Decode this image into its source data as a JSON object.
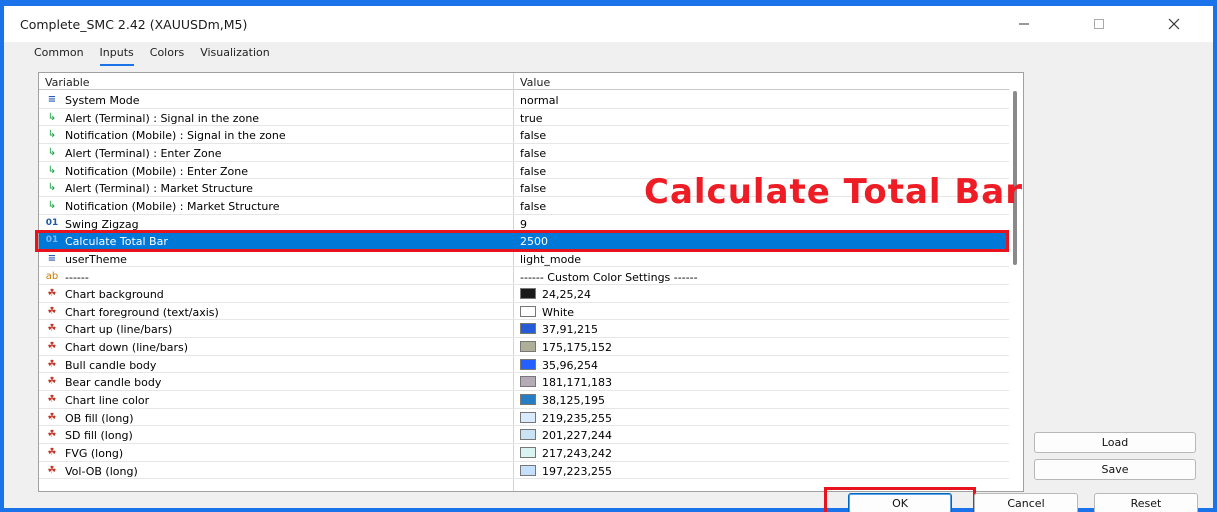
{
  "window": {
    "title": "Complete_SMC 2.42 (XAUUSDm,M5)"
  },
  "tabs": [
    "Common",
    "Inputs",
    "Colors",
    "Visualization"
  ],
  "active_tab": "Inputs",
  "table": {
    "headers": {
      "variable": "Variable",
      "value": "Value"
    },
    "rows": [
      {
        "icon": "system-mode-icon",
        "name": "System Mode",
        "value": "normal"
      },
      {
        "icon": "alert-arrow-icon",
        "name": "Alert (Terminal) : Signal in the zone",
        "value": "true"
      },
      {
        "icon": "alert-arrow-icon",
        "name": "Notification (Mobile) : Signal in the zone",
        "value": "false"
      },
      {
        "icon": "alert-arrow-icon",
        "name": "Alert (Terminal) : Enter Zone",
        "value": "false"
      },
      {
        "icon": "alert-arrow-icon",
        "name": "Notification (Mobile) : Enter Zone",
        "value": "false"
      },
      {
        "icon": "alert-arrow-icon",
        "name": "Alert (Terminal) : Market Structure",
        "value": "false"
      },
      {
        "icon": "alert-arrow-icon",
        "name": "Notification (Mobile) : Market Structure",
        "value": "false"
      },
      {
        "icon": "integer-icon",
        "name": "Swing Zigzag",
        "value": "9"
      },
      {
        "icon": "integer-icon",
        "name": "Calculate Total Bar",
        "value": "2500",
        "selected": true
      },
      {
        "icon": "system-mode-icon",
        "name": "userTheme",
        "value": "light_mode"
      },
      {
        "icon": "string-icon",
        "name": "------",
        "value": "------ Custom Color Settings ------"
      },
      {
        "icon": "color-icon",
        "name": "Chart background",
        "value": "24,25,24",
        "swatch": "#181918"
      },
      {
        "icon": "color-icon",
        "name": "Chart foreground (text/axis)",
        "value": "White",
        "swatch": "#ffffff"
      },
      {
        "icon": "color-icon",
        "name": "Chart up (line/bars)",
        "value": "37,91,215",
        "swatch": "#255bd7"
      },
      {
        "icon": "color-icon",
        "name": "Chart down (line/bars)",
        "value": "175,175,152",
        "swatch": "#afaf98"
      },
      {
        "icon": "color-icon",
        "name": "Bull candle body",
        "value": "35,96,254",
        "swatch": "#2360fe"
      },
      {
        "icon": "color-icon",
        "name": "Bear candle body",
        "value": "181,171,183",
        "swatch": "#b5abb7"
      },
      {
        "icon": "color-icon",
        "name": "Chart line color",
        "value": "38,125,195",
        "swatch": "#267dc3"
      },
      {
        "icon": "color-icon",
        "name": "OB fill (long)",
        "value": "219,235,255",
        "swatch": "#dbebff"
      },
      {
        "icon": "color-icon",
        "name": "SD fill (long)",
        "value": "201,227,244",
        "swatch": "#c9e3f4"
      },
      {
        "icon": "color-icon",
        "name": "FVG (long)",
        "value": "217,243,242",
        "swatch": "#d9f3f2"
      },
      {
        "icon": "color-icon",
        "name": "Vol-OB (long)",
        "value": "197,223,255",
        "swatch": "#c5dfff"
      }
    ]
  },
  "annotation": {
    "text": "Calculate Total Bar",
    "color": "#ee1c25"
  },
  "buttons": {
    "load": "Load",
    "save": "Save",
    "ok": "OK",
    "cancel": "Cancel",
    "reset": "Reset"
  }
}
